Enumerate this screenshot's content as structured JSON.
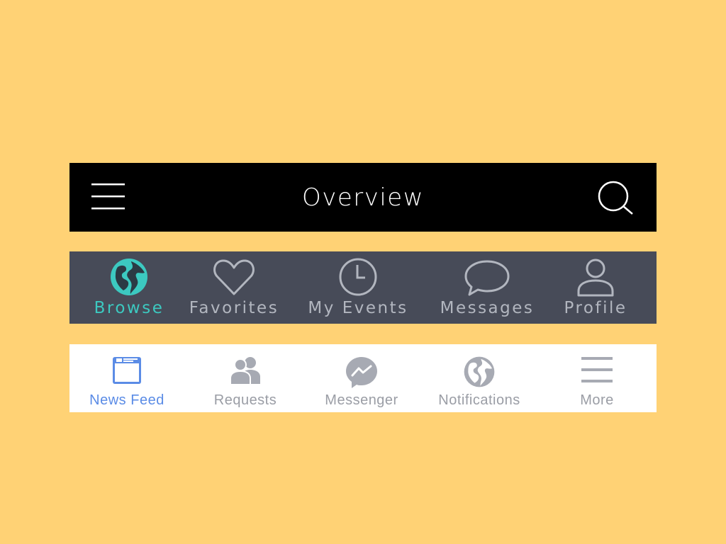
{
  "header": {
    "title": "Overview",
    "menu_icon": "hamburger-menu-icon",
    "search_icon": "search-icon"
  },
  "dark_tabbar": {
    "active_color": "#3CC9C0",
    "inactive_color": "#B2B6BF",
    "tabs": [
      {
        "label": "Browse",
        "icon": "globe-icon",
        "active": true
      },
      {
        "label": "Favorites",
        "icon": "heart-icon",
        "active": false
      },
      {
        "label": "My Events",
        "icon": "clock-icon",
        "active": false
      },
      {
        "label": "Messages",
        "icon": "chat-bubble-icon",
        "active": false
      },
      {
        "label": "Profile",
        "icon": "person-icon",
        "active": false
      }
    ]
  },
  "light_tabbar": {
    "active_color": "#5B8CE6",
    "inactive_color": "#9A9DA5",
    "tabs": [
      {
        "label": "News Feed",
        "icon": "news-feed-icon",
        "active": true
      },
      {
        "label": "Requests",
        "icon": "friends-icon",
        "active": false
      },
      {
        "label": "Messenger",
        "icon": "messenger-icon",
        "active": false
      },
      {
        "label": "Notifications",
        "icon": "globe-icon",
        "active": false
      },
      {
        "label": "More",
        "icon": "hamburger-menu-icon",
        "active": false
      }
    ]
  }
}
